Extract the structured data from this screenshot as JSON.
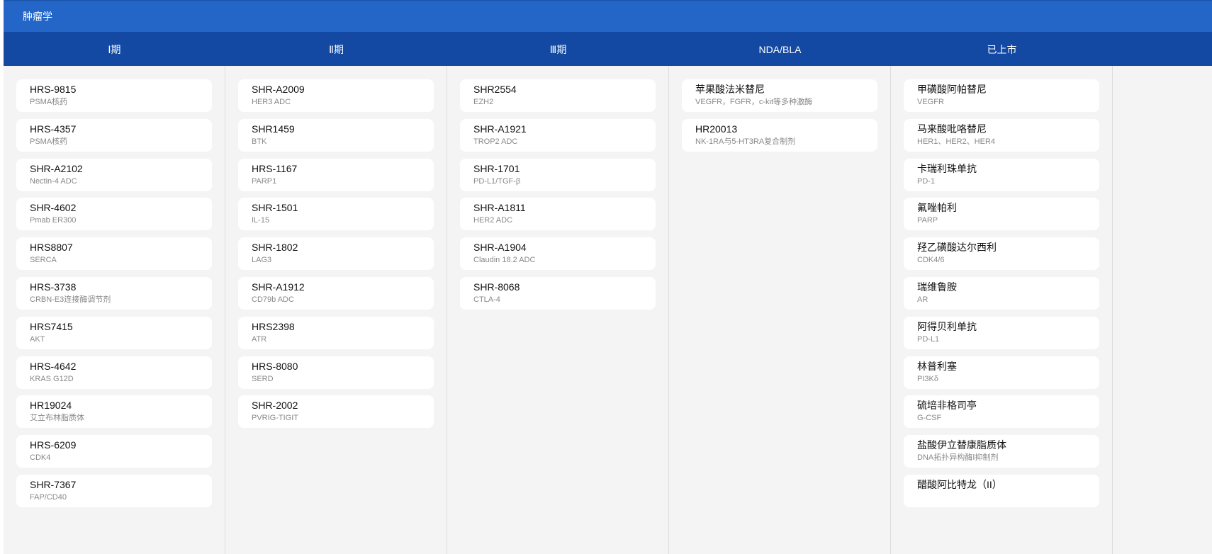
{
  "header": {
    "title": "肿瘤学"
  },
  "colors": {
    "topbar": "#2366c8",
    "phasebar": "#1349a3",
    "background": "#f4f4f4"
  },
  "phases": [
    {
      "label": "Ⅰ期",
      "items": [
        {
          "name": "HRS-9815",
          "target": "PSMA核药"
        },
        {
          "name": "HRS-4357",
          "target": "PSMA核药"
        },
        {
          "name": "SHR-A2102",
          "target": "Nectin-4 ADC"
        },
        {
          "name": "SHR-4602",
          "target": "Pmab ER300"
        },
        {
          "name": "HRS8807",
          "target": "SERCA"
        },
        {
          "name": "HRS-3738",
          "target": "CRBN-E3连接酶调节剂"
        },
        {
          "name": "HRS7415",
          "target": "AKT"
        },
        {
          "name": "HRS-4642",
          "target": "KRAS G12D"
        },
        {
          "name": "HR19024",
          "target": "艾立布林脂质体"
        },
        {
          "name": "HRS-6209",
          "target": "CDK4"
        },
        {
          "name": "SHR-7367",
          "target": "FAP/CD40"
        }
      ]
    },
    {
      "label": "Ⅱ期",
      "items": [
        {
          "name": "SHR-A2009",
          "target": "HER3 ADC"
        },
        {
          "name": "SHR1459",
          "target": "BTK"
        },
        {
          "name": "HRS-1167",
          "target": "PARP1"
        },
        {
          "name": "SHR-1501",
          "target": "IL-15"
        },
        {
          "name": "SHR-1802",
          "target": "LAG3"
        },
        {
          "name": "SHR-A1912",
          "target": "CD79b ADC"
        },
        {
          "name": "HRS2398",
          "target": "ATR"
        },
        {
          "name": "HRS-8080",
          "target": "SERD"
        },
        {
          "name": "SHR-2002",
          "target": "PVRIG-TIGIT"
        }
      ]
    },
    {
      "label": "Ⅲ期",
      "items": [
        {
          "name": "SHR2554",
          "target": "EZH2"
        },
        {
          "name": "SHR-A1921",
          "target": "TROP2 ADC"
        },
        {
          "name": "SHR-1701",
          "target": "PD-L1/TGF-β"
        },
        {
          "name": "SHR-A1811",
          "target": "HER2 ADC"
        },
        {
          "name": "SHR-A1904",
          "target": "Claudin 18.2 ADC"
        },
        {
          "name": "SHR-8068",
          "target": "CTLA-4"
        }
      ]
    },
    {
      "label": "NDA/BLA",
      "items": [
        {
          "name": "苹果酸法米替尼",
          "target": "VEGFR，FGFR，c-kit等多种激酶"
        },
        {
          "name": "HR20013",
          "target": "NK-1RA与5-HT3RA复合制剂"
        }
      ]
    },
    {
      "label": "已上市",
      "items": [
        {
          "name": "甲磺酸阿帕替尼",
          "target": "VEGFR"
        },
        {
          "name": "马来酸吡咯替尼",
          "target": "HER1、HER2、HER4"
        },
        {
          "name": "卡瑞利珠单抗",
          "target": "PD-1"
        },
        {
          "name": "氟唑帕利",
          "target": "PARP"
        },
        {
          "name": "羟乙磺酸达尔西利",
          "target": "CDK4/6"
        },
        {
          "name": "瑞维鲁胺",
          "target": "AR"
        },
        {
          "name": "阿得贝利单抗",
          "target": "PD-L1"
        },
        {
          "name": "林普利塞",
          "target": "PI3Kδ"
        },
        {
          "name": "硫培非格司亭",
          "target": "G-CSF"
        },
        {
          "name": "盐酸伊立替康脂质体",
          "target": "DNA拓扑异构酶Ⅰ抑制剂"
        },
        {
          "name": "醋酸阿比特龙（II）",
          "target": ""
        }
      ]
    }
  ]
}
